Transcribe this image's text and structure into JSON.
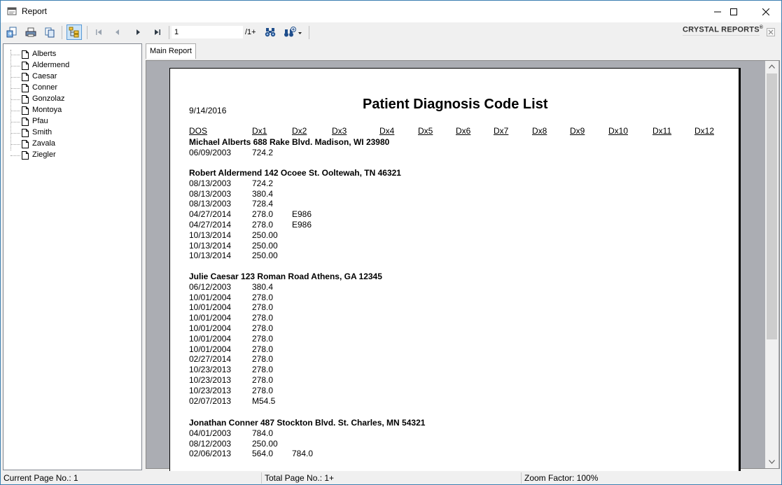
{
  "window": {
    "title": "Report"
  },
  "toolbar": {
    "page_value": "1",
    "page_total": "/1+",
    "brand": "CRYSTAL REPORTS",
    "brand_mark": "®"
  },
  "tree": {
    "items": [
      "Alberts",
      "Aldermend",
      "Caesar",
      "Conner",
      "Gonzolaz",
      "Montoya",
      "Pfau",
      "Smith",
      "Zavala",
      "Ziegler"
    ]
  },
  "tabs": {
    "main": "Main Report"
  },
  "report": {
    "date": "9/14/2016",
    "title": "Patient Diagnosis Code List",
    "headers": [
      "DOS",
      "Dx1",
      "Dx2",
      "Dx3",
      "Dx4",
      "Dx5",
      "Dx6",
      "Dx7",
      "Dx8",
      "Dx9",
      "Dx10",
      "Dx11",
      "Dx12"
    ],
    "patients": [
      {
        "name": "Michael Alberts 688 Rake Blvd. Madison, WI 23980",
        "rows": [
          [
            "06/09/2003",
            "724.2",
            ""
          ]
        ]
      },
      {
        "name": "Robert Aldermend 142 Ocoee St. Ooltewah, TN 46321",
        "rows": [
          [
            "08/13/2003",
            "724.2",
            ""
          ],
          [
            "08/13/2003",
            "380.4",
            ""
          ],
          [
            "08/13/2003",
            "728.4",
            ""
          ],
          [
            "04/27/2014",
            "278.0",
            "E986"
          ],
          [
            "04/27/2014",
            "278.0",
            "E986"
          ],
          [
            "10/13/2014",
            "250.00",
            ""
          ],
          [
            "10/13/2014",
            "250.00",
            ""
          ],
          [
            "10/13/2014",
            "250.00",
            ""
          ]
        ]
      },
      {
        "name": "Julie Caesar 123 Roman Road Athens, GA 12345",
        "rows": [
          [
            "06/12/2003",
            "380.4",
            ""
          ],
          [
            "10/01/2004",
            "278.0",
            ""
          ],
          [
            "10/01/2004",
            "278.0",
            ""
          ],
          [
            "10/01/2004",
            "278.0",
            ""
          ],
          [
            "10/01/2004",
            "278.0",
            ""
          ],
          [
            "10/01/2004",
            "278.0",
            ""
          ],
          [
            "10/01/2004",
            "278.0",
            ""
          ],
          [
            "02/27/2014",
            "278.0",
            ""
          ],
          [
            "10/23/2013",
            "278.0",
            ""
          ],
          [
            "10/23/2013",
            "278.0",
            ""
          ],
          [
            "10/23/2013",
            "278.0",
            ""
          ],
          [
            "02/07/2013",
            "M54.5",
            ""
          ]
        ]
      },
      {
        "name": "Jonathan Conner 487 Stockton Blvd. St. Charles, MN 54321",
        "rows": [
          [
            "04/01/2003",
            "784.0",
            ""
          ],
          [
            "08/12/2003",
            "250.00",
            ""
          ],
          [
            "02/06/2013",
            "564.0",
            "784.0"
          ]
        ]
      }
    ]
  },
  "status": {
    "current_page": "Current Page No.: 1",
    "total_page": "Total Page No.: 1+",
    "zoom": "Zoom Factor: 100%"
  }
}
